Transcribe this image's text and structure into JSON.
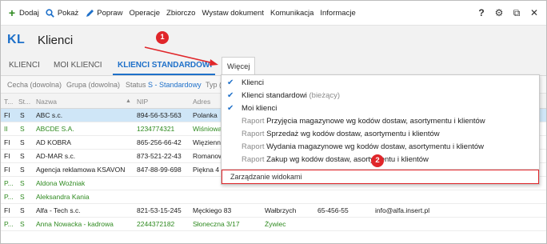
{
  "toolbar": {
    "items": [
      {
        "label": "Dodaj",
        "icon": "plus-icon"
      },
      {
        "label": "Pokaż",
        "icon": "search-icon"
      },
      {
        "label": "Popraw",
        "icon": "pencil-icon"
      },
      {
        "label": "Operacje"
      },
      {
        "label": "Zbiorczo"
      },
      {
        "label": "Wystaw dokument"
      },
      {
        "label": "Komunikacja"
      },
      {
        "label": "Informacje"
      }
    ],
    "right_icons": [
      {
        "name": "help-icon",
        "glyph": "?"
      },
      {
        "name": "gear-icon",
        "glyph": "⚙"
      },
      {
        "name": "restore-window-icon",
        "glyph": "⧉"
      },
      {
        "name": "close-icon",
        "glyph": "✕"
      }
    ]
  },
  "header": {
    "badge": "KL",
    "title": "Klienci"
  },
  "tabs": [
    {
      "label": "KLIENCI"
    },
    {
      "label": "MOI KLIENCI"
    },
    {
      "label": "KLIENCI STANDARDOWI"
    }
  ],
  "more_label": "Więcej",
  "filters": {
    "cecha": "Cecha (dowolna)",
    "grupa": "Grupa (dowolna)",
    "status_label": "Status",
    "status_value": "S - Standardowy",
    "typ": "Typ ("
  },
  "grid": {
    "headers": [
      "T...",
      "St...",
      "Nazwa",
      "NIP",
      "Adres"
    ],
    "rows": [
      {
        "t": "FI",
        "st": "S",
        "name": "ABC s.c.",
        "nip": "894-56-53-563",
        "addr": "Polanka",
        "selected": true,
        "green": false
      },
      {
        "t": "II",
        "st": "S",
        "name": "ABCDE S.A.",
        "nip": "1234774321",
        "addr": "Wiśniowa",
        "selected": false,
        "green": true
      },
      {
        "t": "FI",
        "st": "S",
        "name": "AD KOBRA",
        "nip": "865-256-66-42",
        "addr": "Więzienn",
        "selected": false,
        "green": false
      },
      {
        "t": "FI",
        "st": "S",
        "name": "AD-MAR s.c.",
        "nip": "873-521-22-43",
        "addr": "Romanow",
        "selected": false,
        "green": false
      },
      {
        "t": "FI",
        "st": "S",
        "name": "Agencja reklamowa KSAVON",
        "nip": "847-88-99-698",
        "addr": "Piękna 4",
        "selected": false,
        "green": false
      },
      {
        "t": "P...",
        "st": "S",
        "name": "Aldona Woźniak",
        "nip": "",
        "addr": "",
        "selected": false,
        "green": true
      },
      {
        "t": "P...",
        "st": "S",
        "name": "Aleksandra Kania",
        "nip": "",
        "addr": "",
        "selected": false,
        "green": true
      },
      {
        "t": "FI",
        "st": "S",
        "name": "Alfa - Tech s.c.",
        "nip": "821-53-15-245",
        "addr": "Męckiego  83",
        "city": "Wałbrzych",
        "zip": "65-456-55",
        "email": "info@alfa.insert.pl",
        "selected": false,
        "green": false
      },
      {
        "t": "P...",
        "st": "S",
        "name": "Anna Nowacka - kadrowa",
        "nip": "2244372182",
        "addr": "Słoneczna 3/17",
        "city": "Żywiec",
        "selected": false,
        "green": true
      }
    ]
  },
  "dropdown": {
    "items": [
      {
        "checked": true,
        "prefix": "",
        "label": "Klienci",
        "suffix": ""
      },
      {
        "checked": true,
        "prefix": "",
        "label": "Klienci standardowi",
        "suffix": " (bieżący)"
      },
      {
        "checked": true,
        "prefix": "",
        "label": "Moi klienci",
        "suffix": ""
      },
      {
        "checked": false,
        "prefix": "Raport ",
        "label": "Przyjęcia magazynowe wg kodów dostaw, asortymentu i klientów",
        "suffix": ""
      },
      {
        "checked": false,
        "prefix": "Raport ",
        "label": "Sprzedaż wg kodów dostaw, asortymentu i klientów",
        "suffix": ""
      },
      {
        "checked": false,
        "prefix": "Raport ",
        "label": "Wydania magazynowe wg kodów dostaw, asortymentu i klientów",
        "suffix": ""
      },
      {
        "checked": false,
        "prefix": "Raport ",
        "label": "Zakup wg kodów dostaw, asortymentu i klientów",
        "suffix": ""
      }
    ],
    "manage_label": "Zarządzanie widokami"
  },
  "annotations": {
    "badge1": "1",
    "badge2": "2",
    "color": "#e0262a"
  },
  "colors": {
    "accent": "#1e70c9",
    "green_text": "#2e8a1f",
    "selected_row": "#cfe6f7",
    "highlight": "#e0262a"
  }
}
